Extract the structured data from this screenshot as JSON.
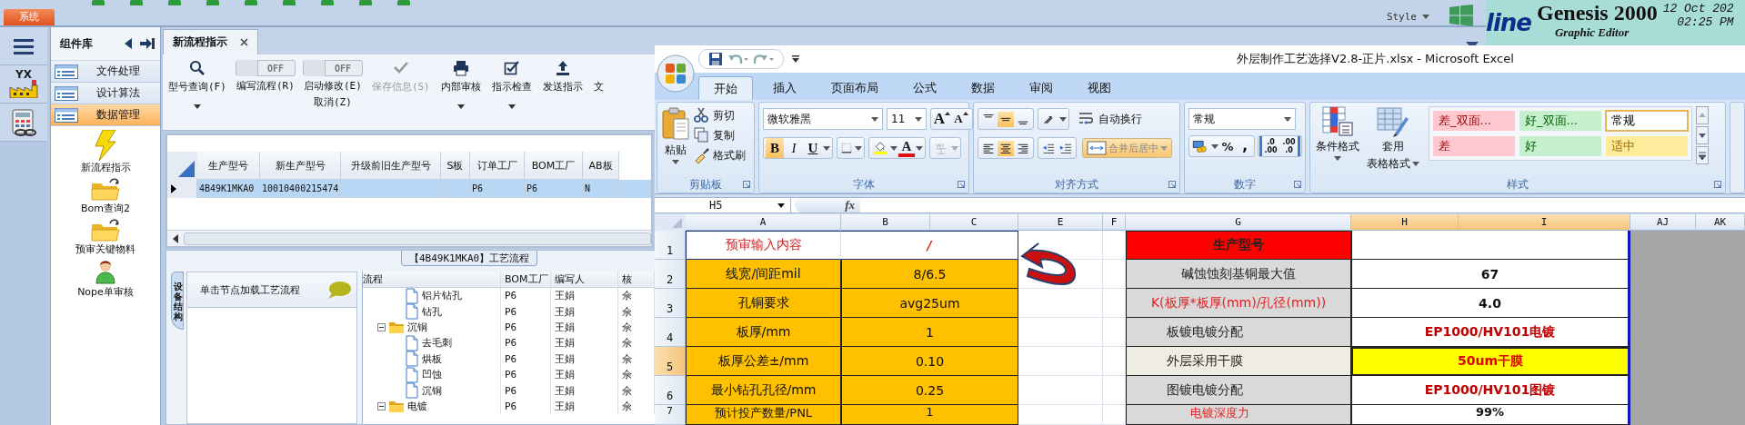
{
  "app": {
    "menu_tab": "系统",
    "style_menu": "Style",
    "side_icons": [
      {
        "kind": "menu"
      },
      {
        "kind": "factory",
        "text": "YX"
      },
      {
        "kind": "calculator"
      }
    ],
    "component_panel": {
      "title": "组件库",
      "categories": [
        {
          "label": "文件处理",
          "selected": false
        },
        {
          "label": "设计算法",
          "selected": false
        },
        {
          "label": "数据管理",
          "selected": true
        }
      ],
      "tools": [
        {
          "label": "新流程指示",
          "kind": "lightning"
        },
        {
          "label": "Bom查询2",
          "kind": "folder"
        },
        {
          "label": "预审关键物料",
          "kind": "folder"
        },
        {
          "label": "Nope单审核",
          "kind": "user"
        }
      ]
    },
    "document_tabs": [
      {
        "label": "新流程指示",
        "selected": true
      }
    ],
    "toolbar": [
      {
        "kind": "button",
        "label": "型号查询(F)",
        "dropdown": true,
        "disabled": false
      },
      {
        "kind": "toggle",
        "state_text": "OFF",
        "on": false,
        "label": "编写流程(R)"
      },
      {
        "kind": "toggle",
        "state_text": "OFF",
        "on": false,
        "label": "启动修改(E)",
        "label_2": "取消(Z)"
      },
      {
        "kind": "button",
        "label": "保存信息(S)",
        "dropdown": false,
        "disabled": true
      },
      {
        "kind": "button",
        "label": "内部审核",
        "dropdown": true,
        "disabled": false
      },
      {
        "kind": "button",
        "label": "指示检查",
        "dropdown": true,
        "disabled": false
      },
      {
        "kind": "button",
        "label": "发送指示",
        "dropdown": false,
        "disabled": false
      },
      {
        "kind": "button",
        "label": "文",
        "dropdown": false,
        "disabled": false
      }
    ],
    "model_grid": {
      "columns": [
        "生产型号",
        "新生产型号",
        "升级前旧生产型号",
        "S板",
        "订单工厂",
        "BOM工厂",
        "AB板"
      ],
      "rows": [
        {
          "selected": true,
          "cells": [
            "4B49K1MKA0",
            "10010400215474",
            null,
            null,
            "P6",
            "P6",
            "N"
          ]
        }
      ]
    },
    "process_panel": {
      "title": "【4B49K1MKA0】工艺流程",
      "side_tab": "设备结构",
      "hint": "单击节点加载工艺流程",
      "columns": [
        "流程",
        "BOM工厂",
        "编写人",
        "核"
      ],
      "tree": [
        {
          "kind": "continued",
          "children": [
            {
              "kind": "step",
              "label": "铝片钻孔",
              "cells": [
                "P6",
                "王娟",
                "佘"
              ]
            },
            {
              "kind": "step",
              "label": "钻孔",
              "cells": [
                "P6",
                "王娟",
                "佘"
              ]
            }
          ]
        },
        {
          "kind": "folder",
          "label": "沉铜",
          "expanded": true,
          "cells": [
            "P6",
            "王娟",
            "佘"
          ],
          "children": [
            {
              "kind": "step",
              "label": "去毛刺",
              "cells": [
                "P6",
                "王娟",
                "佘"
              ]
            },
            {
              "kind": "step",
              "label": "烘板",
              "cells": [
                "P6",
                "王娟",
                "佘"
              ]
            },
            {
              "kind": "step",
              "label": "凹蚀",
              "cells": [
                "P6",
                "王娟",
                "佘"
              ]
            },
            {
              "kind": "step",
              "label": "沉铜",
              "cells": [
                "P6",
                "王娟",
                "佘"
              ]
            }
          ]
        },
        {
          "kind": "folder",
          "label": "电镀",
          "expanded": true,
          "cells": [
            "P6",
            "王娟",
            "佘"
          ]
        }
      ]
    }
  },
  "genesis": {
    "logo_text": "line",
    "title": "Genesis 2000",
    "subtitle": "Graphic Editor",
    "date": "12 Oct 202",
    "time": "02:25 PM"
  },
  "excel": {
    "title": "外层制作工艺选择V2.8-正片.xlsx - Microsoft Excel",
    "ribbon_tabs": [
      {
        "label": "开始",
        "selected": true
      },
      {
        "label": "插入",
        "selected": false
      },
      {
        "label": "页面布局",
        "selected": false
      },
      {
        "label": "公式",
        "selected": false
      },
      {
        "label": "数据",
        "selected": false
      },
      {
        "label": "审阅",
        "selected": false
      },
      {
        "label": "视图",
        "selected": false
      }
    ],
    "clipboard": {
      "group": "剪贴板",
      "paste": "粘贴",
      "actions": [
        {
          "label": "剪切"
        },
        {
          "label": "复制"
        },
        {
          "label": "格式刷"
        }
      ]
    },
    "font": {
      "group": "字体",
      "name": "微软雅黑",
      "size": "11",
      "size_buttons": [
        {
          "kind": "grow",
          "label": "A"
        },
        {
          "kind": "shrink",
          "label": "A"
        }
      ],
      "styles": [
        {
          "kind": "bold",
          "label": "B",
          "selected": true
        },
        {
          "kind": "italic",
          "label": "I",
          "selected": false
        },
        {
          "kind": "underline",
          "label": "U",
          "selected": false
        }
      ],
      "color_label": "A"
    },
    "alignment": {
      "group": "对齐方式",
      "vertical": [
        {
          "kind": "top",
          "selected": false
        },
        {
          "kind": "middle",
          "selected": true
        },
        {
          "kind": "bottom",
          "selected": false
        }
      ],
      "horizontal": [
        {
          "kind": "left",
          "selected": false
        },
        {
          "kind": "center",
          "selected": true
        },
        {
          "kind": "right",
          "selected": false
        }
      ],
      "wrap": "自动换行",
      "merge": {
        "label": "合并后居中",
        "selected": true
      }
    },
    "number": {
      "group": "数字",
      "format": "常规",
      "buttons": [
        {
          "kind": "percent",
          "label": "%"
        },
        {
          "kind": "comma",
          "label": ","
        }
      ],
      "decimals": [
        {
          "kind": "increase",
          "label": ".0",
          "label_2": ".00"
        },
        {
          "kind": "decrease",
          "label": ".00",
          "label_2": ".0"
        }
      ]
    },
    "styles": {
      "group": "样式",
      "conditional": "条件格式",
      "table_format": "套用",
      "table_format_2": "表格格式",
      "cells": [
        {
          "label": "差_双面...",
          "kind": "bad",
          "selected": false
        },
        {
          "label": "好_双面...",
          "kind": "good",
          "selected": false
        },
        {
          "label": "常规",
          "kind": "normal",
          "selected": true
        },
        {
          "label": "差",
          "kind": "bad",
          "selected": false
        },
        {
          "label": "好",
          "kind": "good",
          "selected": false
        },
        {
          "label": "适中",
          "kind": "neutral",
          "selected": false
        }
      ]
    },
    "formula_bar": {
      "name_box": "H5",
      "fx": "fx"
    },
    "columns": [
      {
        "label": "A",
        "selected": false
      },
      {
        "label": "B",
        "selected": false
      },
      {
        "label": "C",
        "selected": false
      },
      {
        "label": "E",
        "selected": false
      },
      {
        "label": "F",
        "selected": false
      },
      {
        "label": "G",
        "selected": false
      },
      {
        "label": "H",
        "selected": true
      },
      {
        "label": "I",
        "selected": true
      },
      {
        "label": "AJ",
        "selected": false
      },
      {
        "label": "AK",
        "selected": false
      }
    ],
    "rows": [
      {
        "header": "1",
        "selected": false,
        "a": {
          "text": "预审输入内容",
          "kind": "title"
        },
        "b": {
          "text": "/",
          "kind": "title"
        },
        "g": {
          "text": "生产型号",
          "kind": "header"
        },
        "h": {
          "kind": "value"
        }
      },
      {
        "header": "2",
        "selected": false,
        "a": {
          "text": "线宽/间距mil",
          "kind": "input"
        },
        "b": {
          "text": "8/6.5",
          "kind": "input"
        },
        "g": {
          "text": "碱蚀蚀刻基铜最大值",
          "kind": "label"
        },
        "h": {
          "text": "67",
          "kind": "value"
        }
      },
      {
        "header": "3",
        "selected": false,
        "a": {
          "text": "孔铜要求",
          "kind": "input"
        },
        "b": {
          "text": "avg25um",
          "kind": "input"
        },
        "g": {
          "text": "K(板厚*板厚(mm)/孔径(mm))",
          "kind": "label-red"
        },
        "h": {
          "text": "4.0",
          "kind": "value"
        }
      },
      {
        "header": "4",
        "selected": false,
        "a": {
          "text": "板厚/mm",
          "kind": "input"
        },
        "b": {
          "text": "1",
          "kind": "input"
        },
        "g": {
          "text": "板镀电镀分配",
          "kind": "label-left"
        },
        "h": {
          "text": "EP1000/HV101电镀",
          "kind": "value-red"
        }
      },
      {
        "header": "5",
        "selected": true,
        "a": {
          "text": "板厚公差±/mm",
          "kind": "input"
        },
        "b": {
          "text": "0.10",
          "kind": "input"
        },
        "g": {
          "text": "外层采用干膜",
          "kind": "label-left"
        },
        "h": {
          "text": "50um干膜",
          "kind": "value-highlight"
        }
      },
      {
        "header": "6",
        "selected": false,
        "a": {
          "text": "最小钻孔孔径/mm",
          "kind": "input"
        },
        "b": {
          "text": "0.25",
          "kind": "input"
        },
        "g": {
          "text": "图镀电镀分配",
          "kind": "label-left"
        },
        "h": {
          "text": "EP1000/HV101图镀",
          "kind": "value-red"
        }
      },
      {
        "header": "7",
        "selected": false,
        "a": {
          "text": "预计投产数量/PNL",
          "kind": "input"
        },
        "b": {
          "text": "1",
          "kind": "input"
        },
        "g": {
          "text": "电镀深度力",
          "kind": "label-red-left"
        },
        "h": {
          "text": "99%",
          "kind": "value"
        }
      }
    ]
  }
}
